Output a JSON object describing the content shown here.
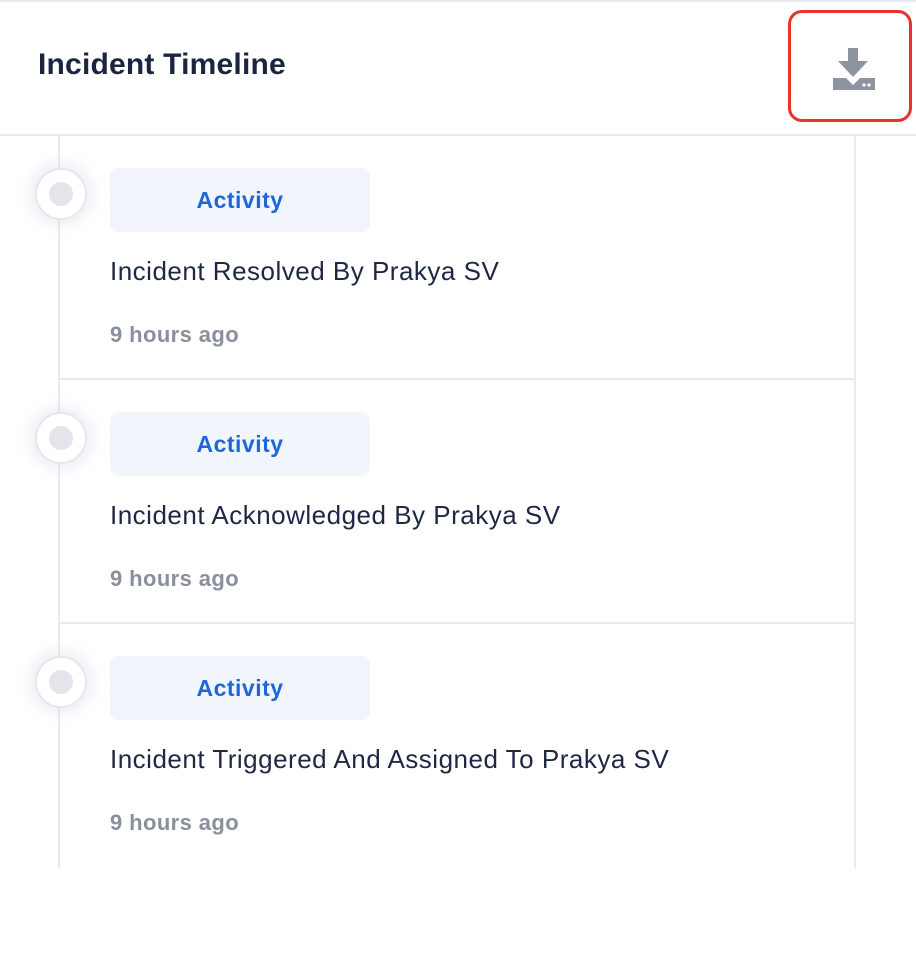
{
  "panel": {
    "title": "Incident Timeline",
    "download_icon": "download-icon"
  },
  "timeline": {
    "items": [
      {
        "badge": "Activity",
        "description": "Incident Resolved By Prakya SV",
        "time": "9 hours ago"
      },
      {
        "badge": "Activity",
        "description": "Incident Acknowledged By Prakya SV",
        "time": "9 hours ago"
      },
      {
        "badge": "Activity",
        "description": "Incident Triggered And Assigned To Prakya SV",
        "time": "9 hours ago"
      }
    ]
  },
  "colors": {
    "accent": "#1d67d9",
    "badge_bg": "#f2f5fb",
    "highlight_border": "#e8332a",
    "muted_text": "#8a8f9c",
    "icon": "#8d93a1"
  }
}
